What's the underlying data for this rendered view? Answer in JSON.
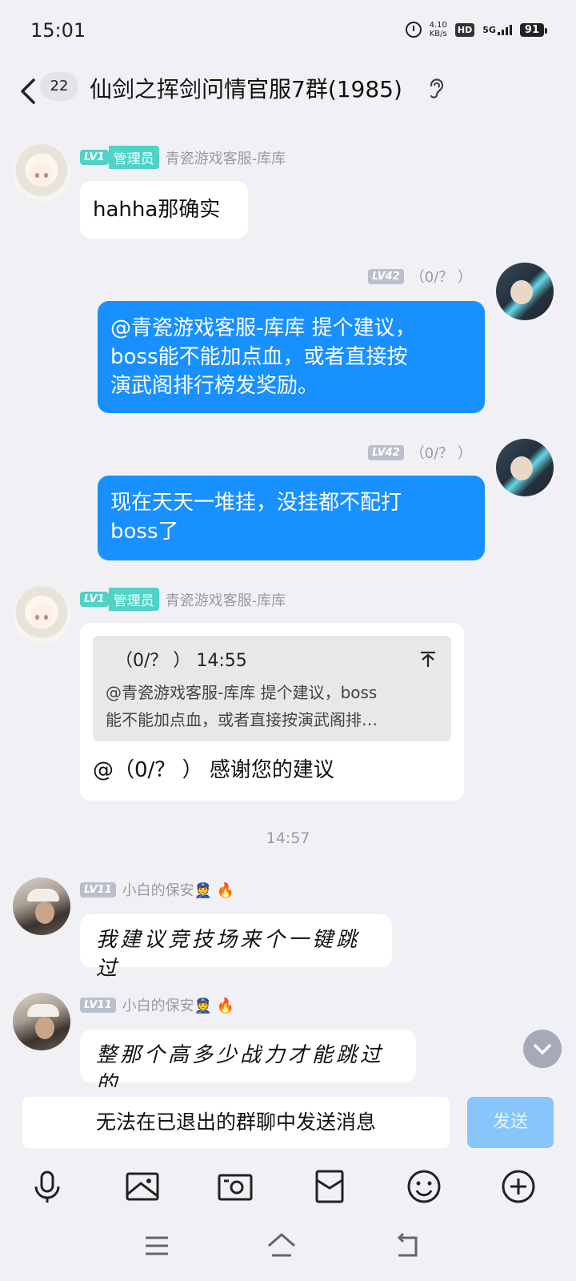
{
  "status_bar": {
    "time": "15:01",
    "net_speed_value": "4.10",
    "net_speed_unit": "KB/s",
    "hd_label": "HD",
    "network": "5G",
    "battery": "91"
  },
  "header": {
    "unread_count": "22",
    "title": "仙剑之挥剑问情官服7群(1985)"
  },
  "messages": [
    {
      "level": "LV1",
      "role": "管理员",
      "sender": "青瓷游戏客服-库库",
      "text": "hahha那确实"
    },
    {
      "level": "LV42",
      "sender": "（0/？ ）",
      "text_lines": [
        "@青瓷游戏客服-库库 提个建议，",
        "boss能不能加点血，或者直接按",
        "演武阁排行榜发奖励。"
      ]
    },
    {
      "level": "LV42",
      "sender": "（0/？ ）",
      "text_lines": [
        "现在天天一堆挂，没挂都不配打",
        "boss了"
      ]
    },
    {
      "level": "LV1",
      "role": "管理员",
      "sender": "青瓷游戏客服-库库",
      "quote_header": "（0/？ ）  14:55",
      "quote_lines": [
        "@青瓷游戏客服-库库 提个建议，boss",
        "能不能加点血，或者直接按演武阁排…"
      ],
      "text": "@（0/？ ）  感谢您的建议"
    },
    {
      "timestamp": "14:57"
    },
    {
      "level": "LV11",
      "sender": "小白的保安👮 🔥",
      "text": "我建议竞技场来个一键跳过"
    },
    {
      "level": "LV11",
      "sender": "小白的保安👮 🔥",
      "text": "整那个高多少战力才能跳过的"
    }
  ],
  "input": {
    "placeholder": "无法在已退出的群聊中发送消息",
    "send_label": "发送"
  },
  "toolbar_icons": [
    "microphone-icon",
    "image-icon",
    "camera-icon",
    "red-packet-icon",
    "emoji-icon",
    "plus-icon"
  ],
  "nav_icons": [
    "menu-icon",
    "home-icon",
    "back-icon"
  ],
  "colors": {
    "background": "#f1f1f5",
    "bubble_blue": "#1890ff",
    "admin_badge": "#4fd3c6",
    "send_disabled": "#87c5fb"
  }
}
